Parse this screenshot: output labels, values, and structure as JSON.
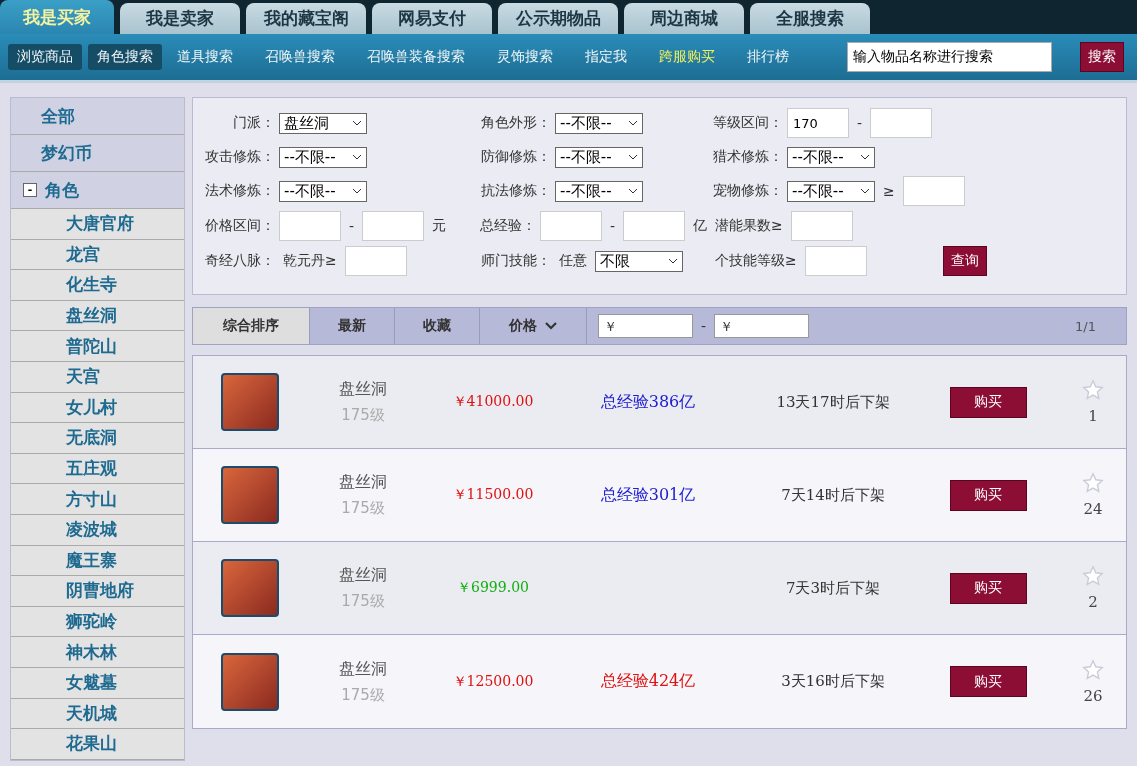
{
  "top_tabs": [
    {
      "label": "我是买家",
      "selected": true
    },
    {
      "label": "我是卖家",
      "selected": false
    },
    {
      "label": "我的藏宝阁",
      "selected": false
    },
    {
      "label": "网易支付",
      "selected": false
    },
    {
      "label": "公示期物品",
      "selected": false
    },
    {
      "label": "周边商城",
      "selected": false
    },
    {
      "label": "全服搜索",
      "selected": false
    }
  ],
  "sub_nav": [
    {
      "label": "浏览商品",
      "selected": true,
      "featured": false
    },
    {
      "label": "角色搜索",
      "selected": true,
      "featured": false
    },
    {
      "label": "道具搜索",
      "selected": false,
      "featured": false
    },
    {
      "label": "召唤兽搜索",
      "selected": false,
      "featured": false
    },
    {
      "label": "召唤兽装备搜索",
      "selected": false,
      "featured": false
    },
    {
      "label": "灵饰搜索",
      "selected": false,
      "featured": false
    },
    {
      "label": "指定我",
      "selected": false,
      "featured": false
    },
    {
      "label": "跨服购买",
      "selected": false,
      "featured": true
    },
    {
      "label": "排行榜",
      "selected": false,
      "featured": false
    }
  ],
  "search": {
    "value": "输入物品名称进行搜索",
    "button": "搜索"
  },
  "sidebar": [
    {
      "label": "全部"
    },
    {
      "label": "梦幻币"
    },
    {
      "label": "角色",
      "toggle": "-",
      "expanded": true,
      "children": [
        {
          "label": "大唐官府"
        },
        {
          "label": "龙宫"
        },
        {
          "label": "化生寺"
        },
        {
          "label": "盘丝洞"
        },
        {
          "label": "普陀山"
        },
        {
          "label": "天宫"
        },
        {
          "label": "女儿村"
        },
        {
          "label": "无底洞"
        },
        {
          "label": "五庄观"
        },
        {
          "label": "方寸山"
        },
        {
          "label": "凌波城"
        },
        {
          "label": "魔王寨"
        },
        {
          "label": "阴曹地府"
        },
        {
          "label": "狮驼岭"
        },
        {
          "label": "神木林"
        },
        {
          "label": "女魃墓"
        },
        {
          "label": "天机城"
        },
        {
          "label": "花果山"
        }
      ]
    }
  ],
  "filters": [
    [
      [
        {
          "kind": "label",
          "text": "门派："
        },
        {
          "kind": "select",
          "value": "盘丝洞"
        }
      ],
      [
        {
          "kind": "label",
          "text": "角色外形："
        },
        {
          "kind": "select",
          "value": "--不限--"
        }
      ],
      [
        {
          "kind": "label",
          "text": "等级区间："
        },
        {
          "kind": "input",
          "value": "170"
        },
        {
          "kind": "text",
          "text": "-"
        },
        {
          "kind": "input"
        }
      ]
    ],
    [
      [
        {
          "kind": "label",
          "text": "攻击修炼："
        },
        {
          "kind": "select",
          "value": "--不限--"
        }
      ],
      [
        {
          "kind": "label",
          "text": "防御修炼："
        },
        {
          "kind": "select",
          "value": "--不限--"
        }
      ],
      [
        {
          "kind": "label",
          "text": "猎术修炼："
        },
        {
          "kind": "select",
          "value": "--不限--"
        }
      ]
    ],
    [
      [
        {
          "kind": "label",
          "text": "法术修炼："
        },
        {
          "kind": "select",
          "value": "--不限--"
        }
      ],
      [
        {
          "kind": "label",
          "text": "抗法修炼："
        },
        {
          "kind": "select",
          "value": "--不限--"
        }
      ],
      [
        {
          "kind": "label",
          "text": "宠物修炼："
        },
        {
          "kind": "select",
          "value": "--不限--"
        },
        {
          "kind": "text",
          "text": "≥"
        },
        {
          "kind": "input"
        }
      ]
    ],
    [
      [
        {
          "kind": "label",
          "text": "价格区间："
        },
        {
          "kind": "input"
        },
        {
          "kind": "text",
          "text": "-"
        },
        {
          "kind": "input"
        },
        {
          "kind": "text",
          "text": "元"
        }
      ],
      [
        {
          "kind": "label",
          "text": "总经验："
        },
        {
          "kind": "input"
        },
        {
          "kind": "text",
          "text": "-"
        },
        {
          "kind": "input"
        },
        {
          "kind": "text",
          "text": "亿"
        }
      ],
      [
        {
          "kind": "text",
          "text": "潜能果数≥"
        },
        {
          "kind": "input"
        }
      ]
    ],
    [
      [
        {
          "kind": "label",
          "text": "奇经八脉："
        },
        {
          "kind": "text",
          "text": "乾元丹≥"
        },
        {
          "kind": "input"
        }
      ],
      [
        {
          "kind": "label",
          "text": "师门技能："
        },
        {
          "kind": "text",
          "text": "任意"
        },
        {
          "kind": "select",
          "value": "不限"
        }
      ],
      [
        {
          "kind": "text",
          "text": "个技能等级≥"
        },
        {
          "kind": "input"
        },
        {
          "kind": "button",
          "text": "查询"
        }
      ]
    ]
  ],
  "sort_tabs": [
    {
      "label": "综合排序",
      "selected": true,
      "caret": false
    },
    {
      "label": "最新",
      "selected": false,
      "caret": false
    },
    {
      "label": "收藏",
      "selected": false,
      "caret": false
    },
    {
      "label": "价格",
      "selected": false,
      "caret": true
    }
  ],
  "price_range": {
    "from_placeholder": "￥",
    "separator": "-",
    "to_placeholder": "￥"
  },
  "pagination": {
    "page": "1/1",
    "prev_disabled": true,
    "next_disabled": true
  },
  "listings": [
    {
      "school": "盘丝洞",
      "level": "175级",
      "price": {
        "text": "￥41000.00",
        "color": "#e01010"
      },
      "experience": {
        "text": "总经验386亿",
        "color": "#2020d0"
      },
      "time": "13天17时后下架",
      "button": "购买",
      "favorites": "1"
    },
    {
      "school": "盘丝洞",
      "level": "175级",
      "price": {
        "text": "￥11500.00",
        "color": "#e01010"
      },
      "experience": {
        "text": "总经验301亿",
        "color": "#2020d0"
      },
      "time": "7天14时后下架",
      "button": "购买",
      "favorites": "24"
    },
    {
      "school": "盘丝洞",
      "level": "175级",
      "price": {
        "text": "￥6999.00",
        "color": "#10b010"
      },
      "time": "7天3时后下架",
      "button": "购买",
      "favorites": "2"
    },
    {
      "school": "盘丝洞",
      "level": "175级",
      "price": {
        "text": "￥12500.00",
        "color": "#e01010"
      },
      "experience": {
        "text": "总经验424亿",
        "color": "#e01010"
      },
      "time": "3天16时后下架",
      "button": "购买",
      "favorites": "26"
    }
  ]
}
